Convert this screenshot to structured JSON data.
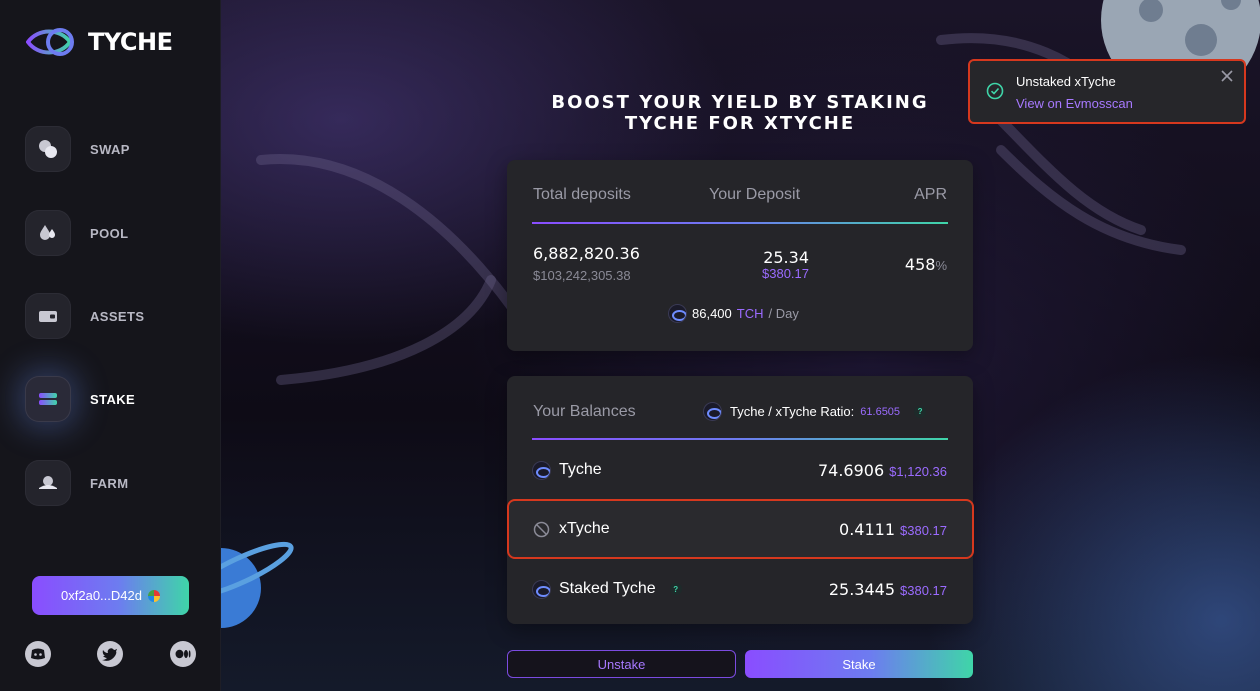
{
  "app": {
    "name": "TYCHE"
  },
  "sidebar": {
    "items": [
      {
        "label": "SWAP",
        "icon": "swap-icon"
      },
      {
        "label": "POOL",
        "icon": "pool-icon"
      },
      {
        "label": "ASSETS",
        "icon": "wallet-icon"
      },
      {
        "label": "STAKE",
        "icon": "stake-icon",
        "active": true
      },
      {
        "label": "FARM",
        "icon": "farm-icon"
      }
    ],
    "wallet": {
      "address": "0xf2a0...D42d"
    },
    "socials": [
      "discord-icon",
      "twitter-icon",
      "medium-icon"
    ]
  },
  "page": {
    "title_line1": "BOOST YOUR YIELD BY STAKING",
    "title_line2": "TYCHE FOR XTYCHE"
  },
  "deposits": {
    "headers": {
      "total": "Total deposits",
      "yours": "Your Deposit",
      "apr": "APR"
    },
    "total_amount": "6,882,820.36",
    "total_usd": "$103,242,305.38",
    "your_amount": "25.34",
    "your_usd": "$380.17",
    "apr_value": "458",
    "apr_unit": "%",
    "emission_amount": "86,400",
    "emission_token": "TCH",
    "emission_period": "/ Day"
  },
  "balances": {
    "title": "Your Balances",
    "ratio_label": "Tyche / xTyche Ratio:",
    "ratio_value": "61.6505",
    "rows": [
      {
        "token": "Tyche",
        "amount": "74.6906",
        "usd": "$1,120.36"
      },
      {
        "token": "xTyche",
        "amount": "0.4111",
        "usd": "$380.17"
      },
      {
        "token": "Staked Tyche",
        "amount": "25.3445",
        "usd": "$380.17"
      }
    ]
  },
  "actions": {
    "unstake": "Unstake",
    "stake": "Stake"
  },
  "toast": {
    "title": "Unstaked xTyche",
    "link": "View on Evmosscan"
  },
  "colors": {
    "accent_purple": "#8a4dff",
    "accent_teal": "#3fd5a8",
    "highlight_red": "#d6381e",
    "card": "#252529"
  }
}
